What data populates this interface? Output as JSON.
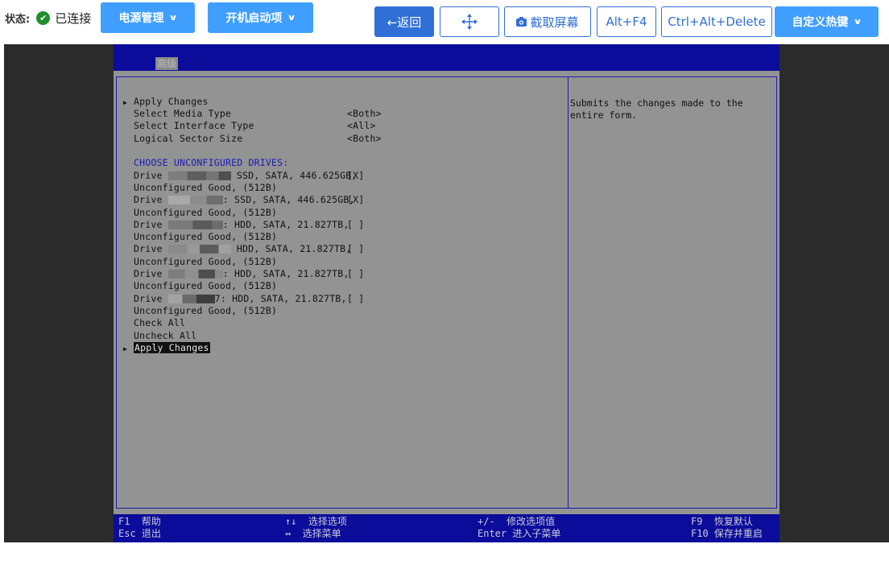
{
  "toolbar": {
    "status_label": "状态:",
    "status_value": "已连接",
    "power_menu": "电源管理",
    "boot_menu": "开机启动项",
    "back": "←返回",
    "move_icon": "move-arrows-icon",
    "screenshot": "截取屏幕",
    "alt_f4": "Alt+F4",
    "ctrl_alt_del": "Ctrl+Alt+Delete",
    "custom_hotkey": "自定义热键"
  },
  "bios": {
    "tab": "高级",
    "items": [
      {
        "label": "Apply Changes",
        "value": ""
      },
      {
        "label": "Select Media Type",
        "value": "<Both>"
      },
      {
        "label": "Select Interface Type",
        "value": "<All>"
      },
      {
        "label": "Logical Sector Size",
        "value": "<Both>"
      }
    ],
    "section_header": "CHOOSE UNCONFIGURED DRIVES:",
    "drives": [
      {
        "prefix": "Drive ",
        "info": " SSD, SATA, 446.625GB,",
        "check": "[X]",
        "status": "Unconfigured Good, (512B)"
      },
      {
        "prefix": "Drive ",
        "info": ": SSD, SATA, 446.625GB,",
        "check": "[X]",
        "status": "Unconfigured Good, (512B)"
      },
      {
        "prefix": "Drive ",
        "info": ": HDD, SATA, 21.827TB,",
        "check": "[ ]",
        "status": "Unconfigured Good, (512B)"
      },
      {
        "prefix": "Drive ",
        "info": " HDD, SATA, 21.827TB,",
        "check": "[ ]",
        "status": "Unconfigured Good, (512B)"
      },
      {
        "prefix": "Drive ",
        "info": ": HDD, SATA, 21.827TB,",
        "check": "[ ]",
        "status": "Unconfigured Good, (512B)"
      },
      {
        "prefix": "Drive ",
        "info": "7: HDD, SATA, 21.827TB,",
        "check": "[ ]",
        "status": "Unconfigured Good, (512B)"
      }
    ],
    "check_all": "Check All",
    "uncheck_all": "Uncheck All",
    "apply_changes_bottom": "Apply Changes",
    "help_text": "Submits the changes made to the\nentire form.",
    "footer": {
      "f1": "F1  帮助",
      "esc": "Esc 退出",
      "arrows_ud": "↑↓  选择选项",
      "arrows_lr": "↔  选择菜单",
      "plusminus": "+/-  修改选项值",
      "enter": "Enter 进入子菜单",
      "f9": "F9  恢复默认",
      "f10": "F10 保存并重启"
    }
  },
  "colors": {
    "primary": "#409eff",
    "primary_dark": "#2f6fd6",
    "bios_bar": "#0b0c9a",
    "bios_bg": "#939393",
    "bios_blue_text": "#1a1ab4",
    "connected": "#1f8f2e"
  }
}
